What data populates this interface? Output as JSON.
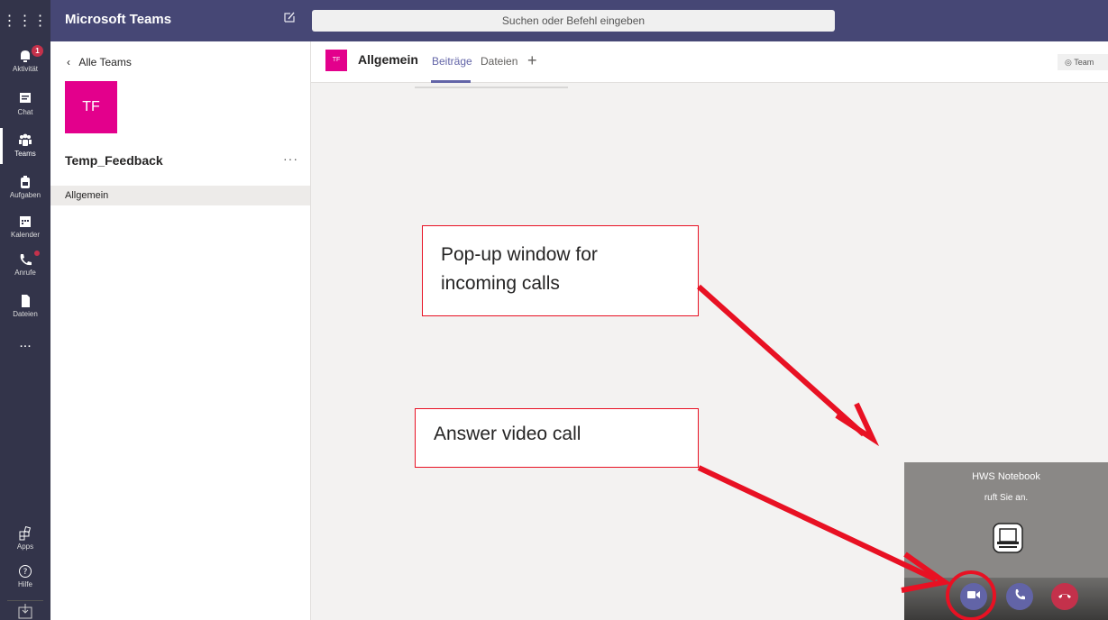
{
  "app": {
    "title": "Microsoft Teams",
    "search_placeholder": "Suchen oder Befehl eingeben"
  },
  "rail": {
    "items": [
      {
        "label": "Aktivität",
        "icon": "bell-icon",
        "badge": "1"
      },
      {
        "label": "Chat",
        "icon": "chat-icon"
      },
      {
        "label": "Teams",
        "icon": "teams-icon",
        "active": true
      },
      {
        "label": "Aufgaben",
        "icon": "tasks-icon"
      },
      {
        "label": "Kalender",
        "icon": "calendar-icon"
      },
      {
        "label": "Anrufe",
        "icon": "phone-icon",
        "dot": true
      },
      {
        "label": "Dateien",
        "icon": "files-icon"
      },
      {
        "label": "...",
        "icon": "more-icon"
      }
    ],
    "bottom": [
      {
        "label": "Apps",
        "icon": "apps-icon"
      },
      {
        "label": "Hilfe",
        "icon": "help-icon"
      }
    ]
  },
  "team_panel": {
    "back_label": "Alle Teams",
    "initials": "TF",
    "team_name": "Temp_Feedback",
    "more": "···",
    "channel": "Allgemein"
  },
  "channel": {
    "initials": "TF",
    "title": "Allgemein",
    "tabs": [
      "Beiträge",
      "Dateien"
    ],
    "add": "+",
    "team_button": "Team"
  },
  "annotations": {
    "popup_line1": "Pop-up window for",
    "popup_line2": "incoming calls",
    "answer": "Answer video call"
  },
  "call": {
    "caller": "HWS Notebook",
    "subtitle": "ruft Sie an."
  },
  "colors": {
    "brand": "#6264a7",
    "rail": "#33344a",
    "team_tile": "#e3008c",
    "decline": "#c4314b",
    "annotation": "#e81123"
  }
}
